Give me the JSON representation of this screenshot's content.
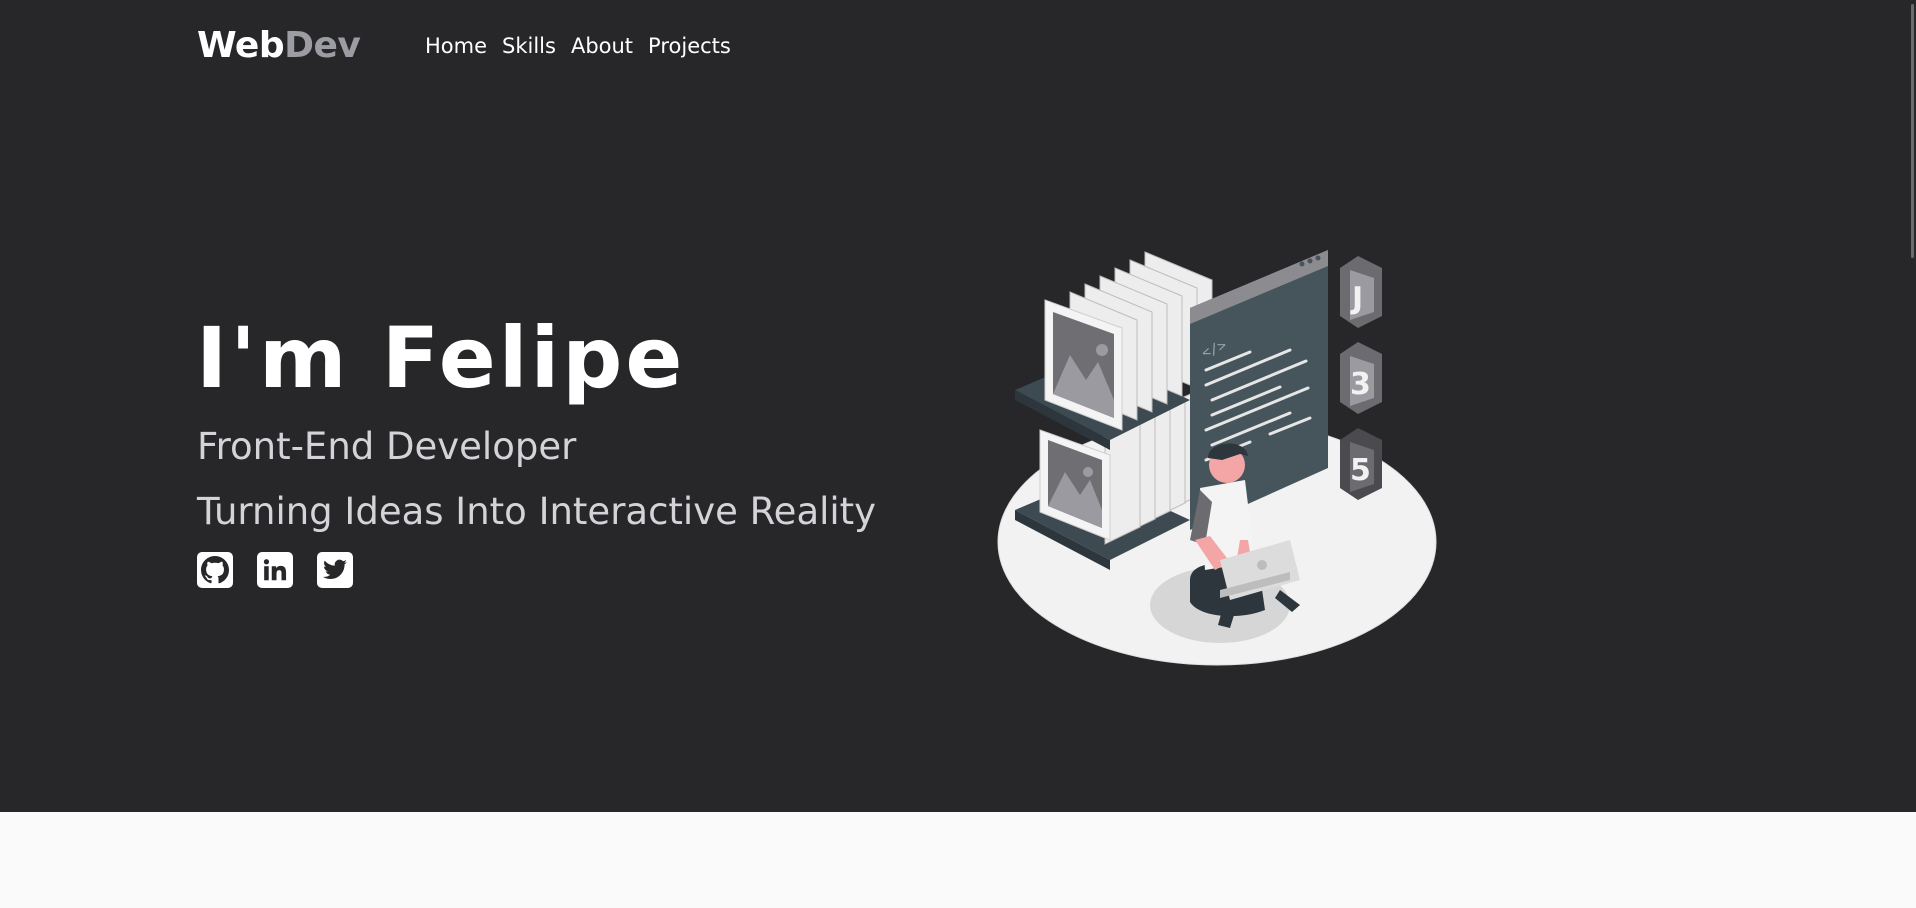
{
  "nav": {
    "logo_primary": "Web",
    "logo_secondary": "Dev",
    "links": [
      "Home",
      "Skills",
      "About",
      "Projects"
    ]
  },
  "hero": {
    "title": "I'm Felipe",
    "subtitle": "Front-End Developer",
    "tagline": "Turning Ideas Into Interactive Reality"
  },
  "socials": [
    {
      "icon": "github-icon"
    },
    {
      "icon": "linkedin-icon"
    },
    {
      "icon": "twitter-icon"
    }
  ],
  "colors": {
    "hero_background": "#27272a",
    "page_background": "#fafafa",
    "logo_accent": "#9c9ca3",
    "text_muted": "#d4d4d8"
  }
}
